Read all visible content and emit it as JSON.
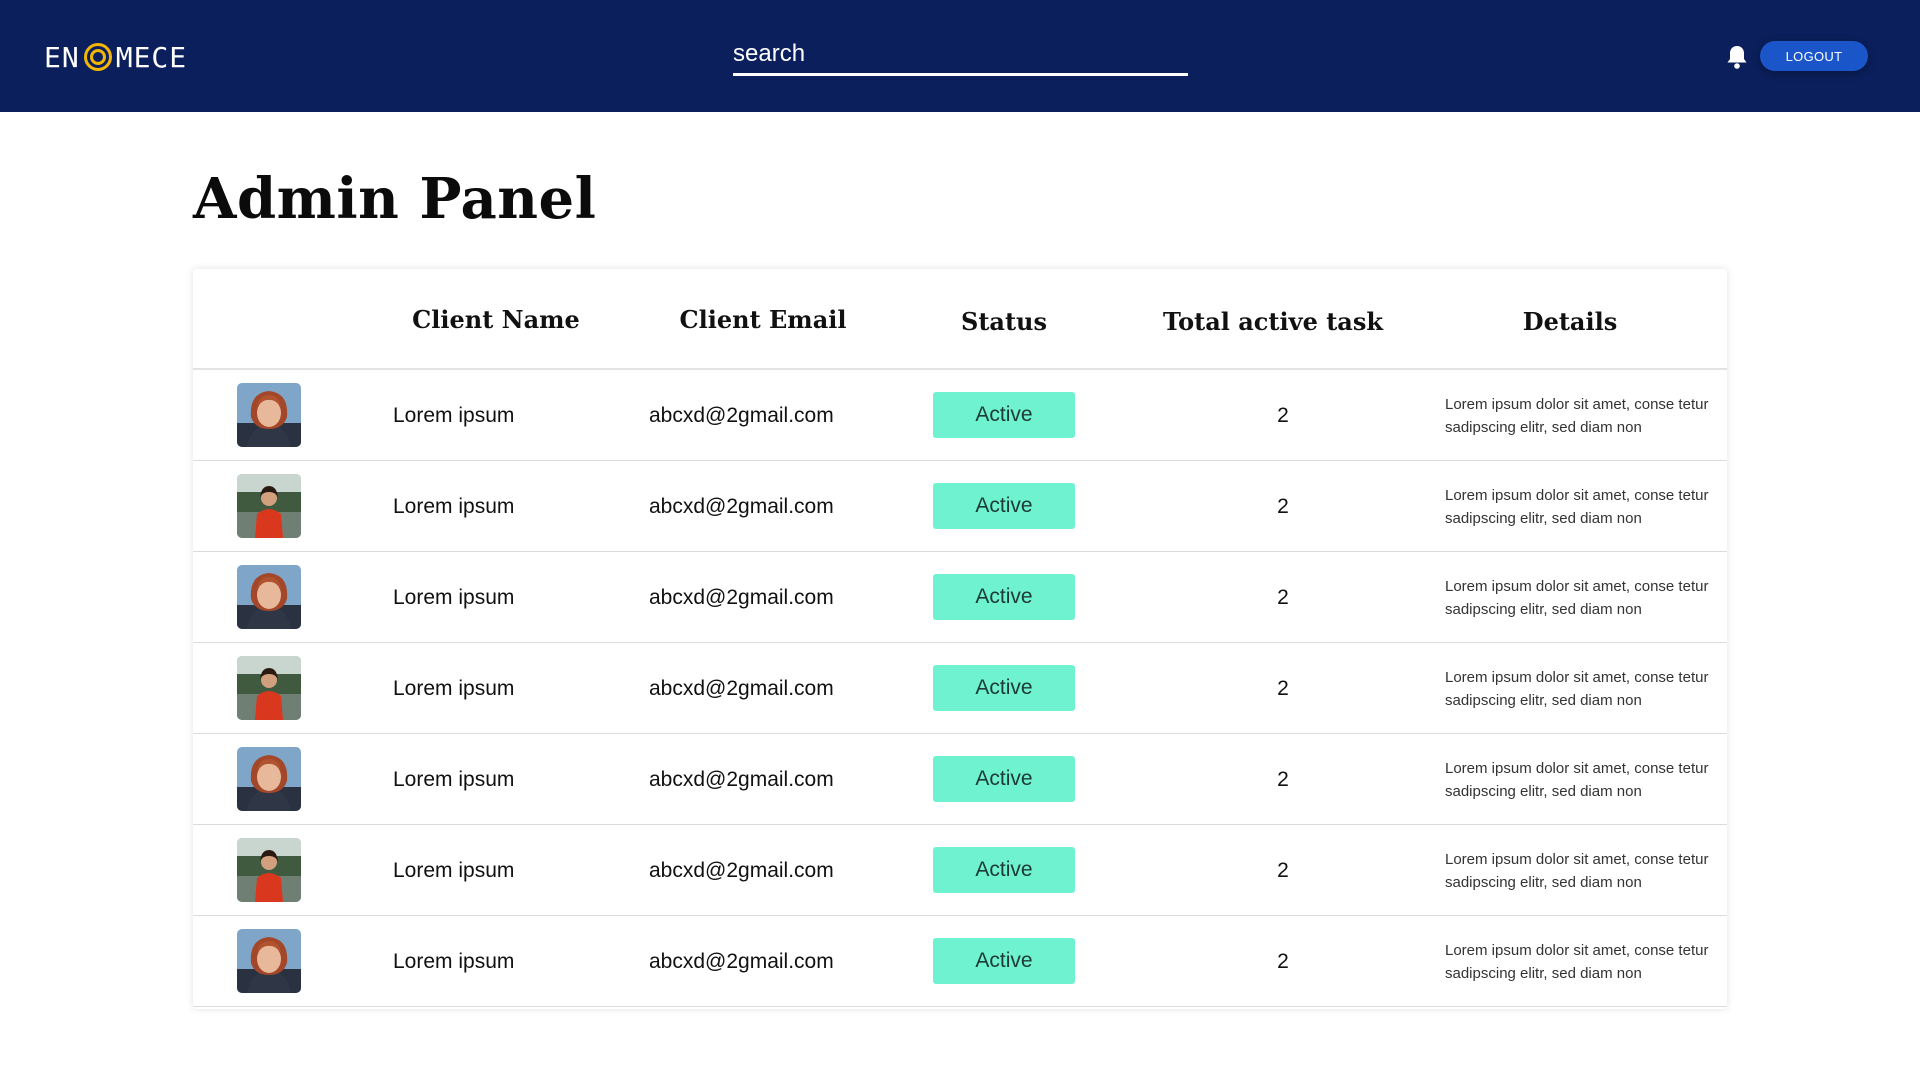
{
  "header": {
    "logo_text_left": "EN",
    "logo_text_right": "MECE",
    "search_placeholder": "search",
    "logout_label": "LOGOUT"
  },
  "page": {
    "title": "Admin Panel"
  },
  "table": {
    "columns": {
      "name": "Client Name",
      "email": "Client Email",
      "status": "Status",
      "tasks": "Total active task",
      "details": "Details"
    },
    "rows": [
      {
        "avatar": "woman-portrait-blue",
        "name": "Lorem ipsum",
        "email": "abcxd@2gmail.com",
        "status": "Active",
        "tasks": "2",
        "details": "Lorem ipsum dolor sit amet, conse tetur sadipscing elitr, sed diam non"
      },
      {
        "avatar": "woman-red-dress",
        "name": "Lorem ipsum",
        "email": "abcxd@2gmail.com",
        "status": "Active",
        "tasks": "2",
        "details": "Lorem ipsum dolor sit amet, conse tetur sadipscing elitr, sed diam non"
      },
      {
        "avatar": "woman-portrait-blue",
        "name": "Lorem ipsum",
        "email": "abcxd@2gmail.com",
        "status": "Active",
        "tasks": "2",
        "details": "Lorem ipsum dolor sit amet, conse tetur sadipscing elitr, sed diam non"
      },
      {
        "avatar": "woman-red-dress",
        "name": "Lorem ipsum",
        "email": "abcxd@2gmail.com",
        "status": "Active",
        "tasks": "2",
        "details": "Lorem ipsum dolor sit amet, conse tetur sadipscing elitr, sed diam non"
      },
      {
        "avatar": "woman-portrait-blue",
        "name": "Lorem ipsum",
        "email": "abcxd@2gmail.com",
        "status": "Active",
        "tasks": "2",
        "details": "Lorem ipsum dolor sit amet, conse tetur sadipscing elitr, sed diam non"
      },
      {
        "avatar": "woman-red-dress",
        "name": "Lorem ipsum",
        "email": "abcxd@2gmail.com",
        "status": "Active",
        "tasks": "2",
        "details": "Lorem ipsum dolor sit amet, conse tetur sadipscing elitr, sed diam non"
      },
      {
        "avatar": "woman-portrait-blue",
        "name": "Lorem ipsum",
        "email": "abcxd@2gmail.com",
        "status": "Active",
        "tasks": "2",
        "details": "Lorem ipsum dolor sit amet, conse tetur sadipscing elitr, sed diam non"
      }
    ]
  },
  "colors": {
    "header_bg": "#0b1f5c",
    "logo_accent": "#f2b705",
    "logout_bg": "#1a56c9",
    "status_active_bg": "#6ef2cf"
  },
  "icons": {
    "bell": "bell-icon"
  }
}
